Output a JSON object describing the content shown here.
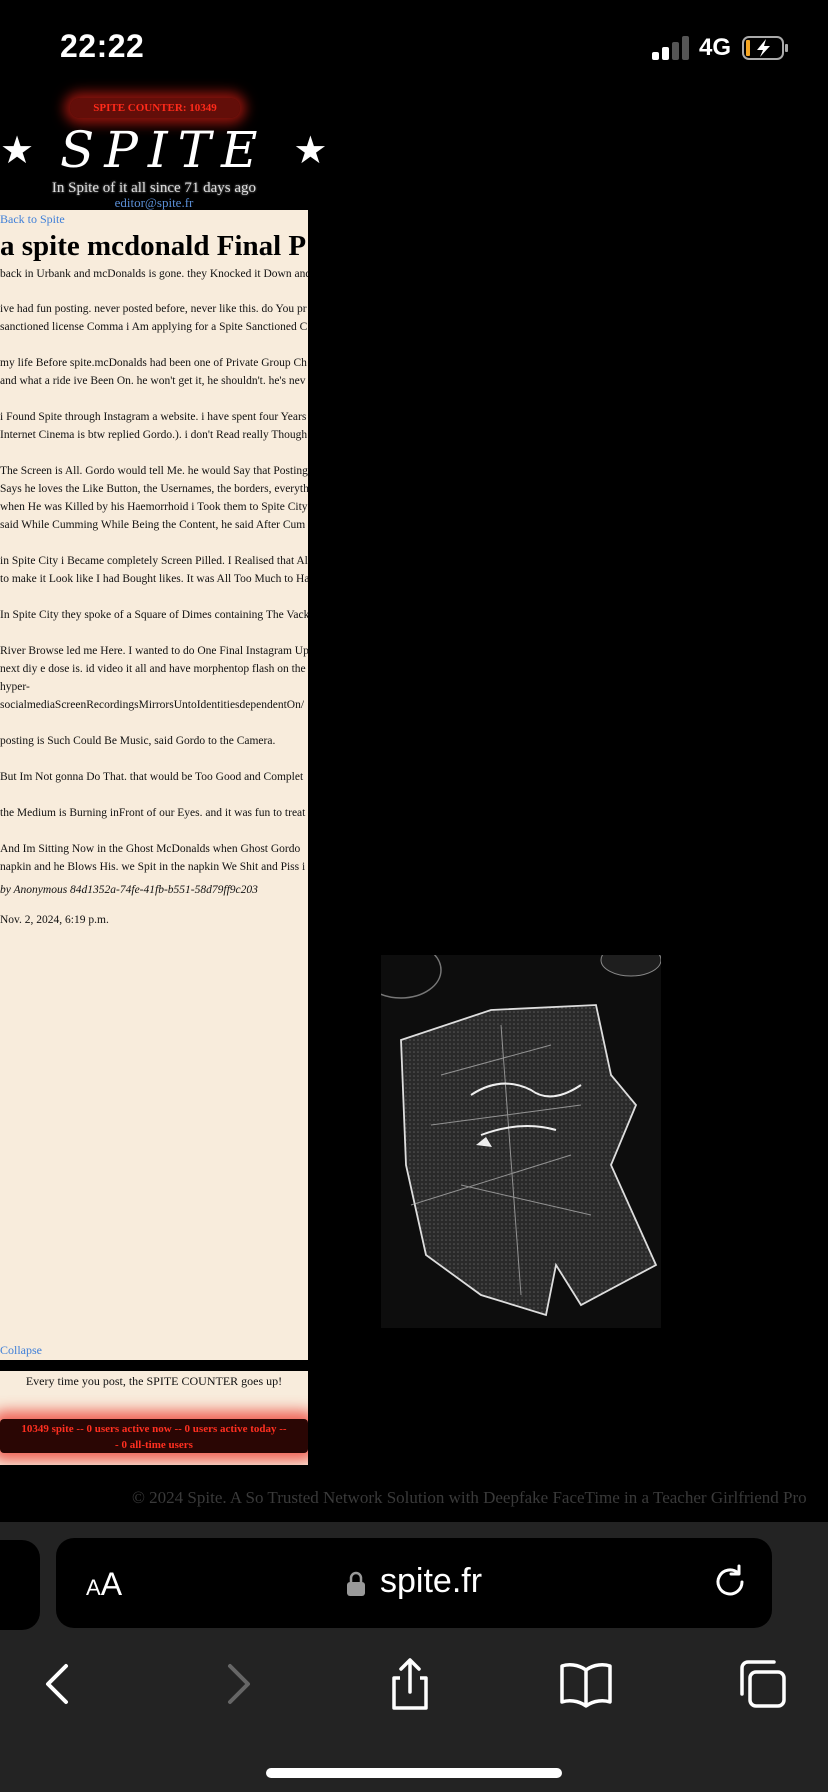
{
  "status": {
    "time": "22:22",
    "network": "4G"
  },
  "header": {
    "counter": "SPITE COUNTER: 10349",
    "logo_star_left": "★",
    "logo_text": "SPITE",
    "logo_star_right": "★",
    "tagline": "In Spite of it all since 71 days ago",
    "email": "editor@spite.fr"
  },
  "article": {
    "back_link": "Back to Spite",
    "title": "a spite mcdonald Final P",
    "lines": [
      "back in Urbank and mcDonalds is gone. they Knocked it Down and",
      "ive had fun posting. never posted before, never like this. do You pr",
      "sanctioned license Comma i Am applying for a Spite Sanctioned C",
      "my life Before spite.mcDonalds had been one of Private Group Ch",
      "and what a ride ive Been On. he won't get it, he shouldn't. he's nev",
      "i Found Spite through Instagram a website. i have spent four Years",
      "Internet Cinema is btw replied Gordo.). i don't Read really Though",
      "The Screen is All. Gordo would tell Me. he would Say that Posting",
      "Says he loves the Like Button, the Usernames, the borders, everyth",
      "when He was Killed by his Haemorrhoid i Took them to Spite City",
      "said While Cumming While Being the Content, he said After Cum",
      "in Spite City i Became completely Screen Pilled. I Realised that All",
      "to make it Look like I had Bought likes. It was All Too Much to Ha",
      "In Spite City they spoke of a Square of Dimes containing The Vack",
      "River Browse led me Here. I wanted to do One Final Instagram Up",
      "next diy e dose is. id video it all and have morphentop flash on the",
      "hyper-",
      "socialmediaScreenRecordingsMirrorsUntoIdentitiesdependentOn/",
      "posting is Such Could Be Music, said Gordo to the Camera.",
      "But Im Not gonna Do That. that would be Too Good and Complet",
      "the Medium is Burning inFront of our Eyes. and it was fun to treat",
      "And Im Sitting Now in the Ghost McDonalds when Ghost Gordo",
      "napkin and he Blows His. we Spit in the napkin We Shit and Piss i"
    ],
    "byline": "by Anonymous 84d1352a-74fe-41fb-b551-58d79ff9c203",
    "date": "Nov. 2, 2024, 6:19 p.m.",
    "collapse": "Collapse"
  },
  "promo": {
    "text": "Every time you post, the SPITE COUNTER goes up!",
    "red_line1": "10349 spite -- 0 users active now -- 0 users active today --",
    "red_line2": "- 0 all-time users"
  },
  "footer": "© 2024 Spite. A So Trusted Network Solution with Deepfake FaceTime in a Teacher Girlfriend Pro",
  "browser": {
    "text_size_small": "A",
    "text_size_large": "A",
    "url": "spite.fr"
  },
  "colors": {
    "panel": "#f8ecdc",
    "link": "#3f7fd8",
    "counter_red": "#ff2a1a"
  }
}
